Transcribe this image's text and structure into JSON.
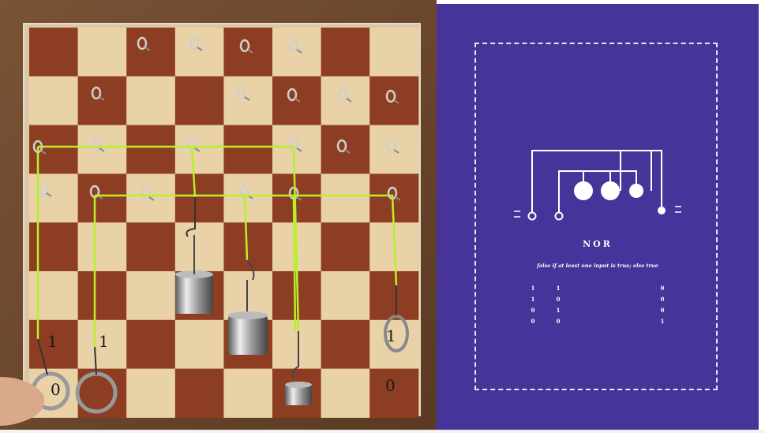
{
  "board": {
    "labels": {
      "top_left": "1",
      "top_mid": "1",
      "bottom_left": "0",
      "right_ring": "1",
      "bottom_right": "0"
    }
  },
  "diagram": {
    "gate_name": "NOR",
    "description": "false if at least one input is true; else true",
    "truth_table": [
      [
        "1",
        "1",
        "0"
      ],
      [
        "1",
        "0",
        "0"
      ],
      [
        "0",
        "1",
        "0"
      ],
      [
        "0",
        "0",
        "1"
      ]
    ],
    "colors": {
      "background": "#47349a",
      "foreground": "#ffffff"
    }
  }
}
